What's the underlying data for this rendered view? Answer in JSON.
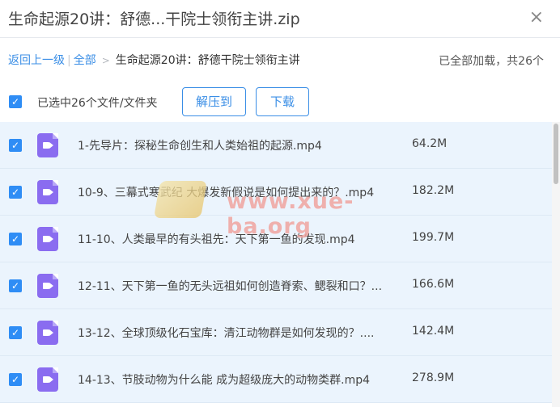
{
  "title": "生命起源20讲：舒德...干院士领衔主讲.zip",
  "close_icon": "×",
  "breadcrumb": {
    "back_label": "返回上一级",
    "all_label": "全部",
    "current": "生命起源20讲：舒德干院士领衔主讲"
  },
  "status": "已全部加载，共26个",
  "selection": {
    "text": "已选中26个文件/文件夹",
    "check": "✓"
  },
  "actions": {
    "extract_label": "解压到",
    "download_label": "下载"
  },
  "files": [
    {
      "name": "1-先导片：探秘生命创生和人类始祖的起源.mp4",
      "size": "64.2M",
      "check": "✓"
    },
    {
      "name": "10-9、三幕式寒武纪 大爆发新假说是如何提出来的？.mp4",
      "size": "182.2M",
      "check": "✓"
    },
    {
      "name": "11-10、人类最早的有头祖先：天下第一鱼的发现.mp4",
      "size": "199.7M",
      "check": "✓"
    },
    {
      "name": "12-11、天下第一鱼的无头远祖如何创造脊索、鳃裂和口？...",
      "size": "166.6M",
      "check": "✓"
    },
    {
      "name": "13-12、全球顶级化石宝库：清江动物群是如何发现的？....",
      "size": "142.4M",
      "check": "✓"
    },
    {
      "name": "14-13、节肢动物为什么能 成为超级庞大的动物类群.mp4",
      "size": "278.9M",
      "check": "✓"
    }
  ],
  "watermark": {
    "text": "www.xue-ba.org"
  },
  "colors": {
    "accent": "#3a8ee6",
    "row_bg": "#ebf4fd",
    "video_icon": "#8a6cf0"
  }
}
